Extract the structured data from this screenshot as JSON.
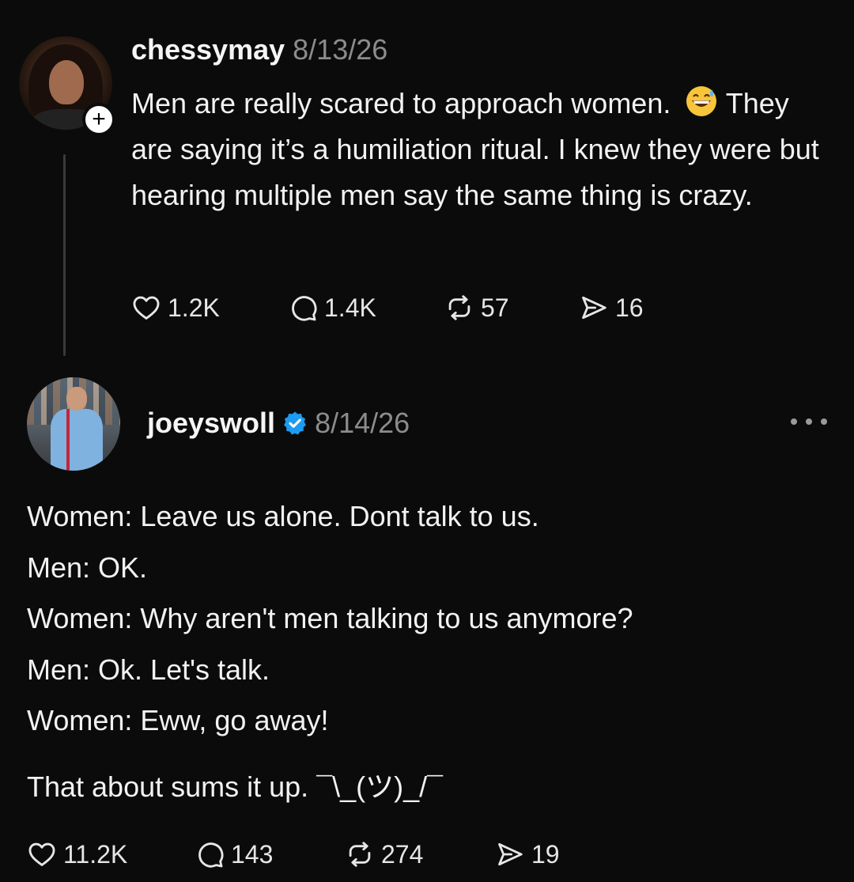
{
  "post1": {
    "username": "chessymay",
    "date": "8/13/26",
    "follow_symbol": "+",
    "body_line1": "Men are really scared to approach women.",
    "body_rest": "They are saying it’s a humiliation ritual. I knew they were but hearing multiple men say the same thing is crazy.",
    "emoji_icon": "grinning-sweat-emoji",
    "likes": "1.2K",
    "replies": "1.4K",
    "reposts": "57",
    "shares": "16"
  },
  "post2": {
    "username": "joeyswoll",
    "verified": true,
    "date": "8/14/26",
    "lines": [
      "Women: Leave us alone. Dont talk to us.",
      "Men: OK.",
      "Women: Why aren't men talking to us anymore?",
      "Men: Ok. Let's talk.",
      "Women: Eww, go away!"
    ],
    "closing": "That about sums it up. ¯\\_(ツ)_/¯",
    "likes": "11.2K",
    "replies": "143",
    "reposts": "274",
    "shares": "19"
  },
  "colors": {
    "background": "#0b0b0b",
    "text": "#f2f2f2",
    "muted": "#8c8c8c",
    "verified_blue": "#1d9bf0"
  }
}
